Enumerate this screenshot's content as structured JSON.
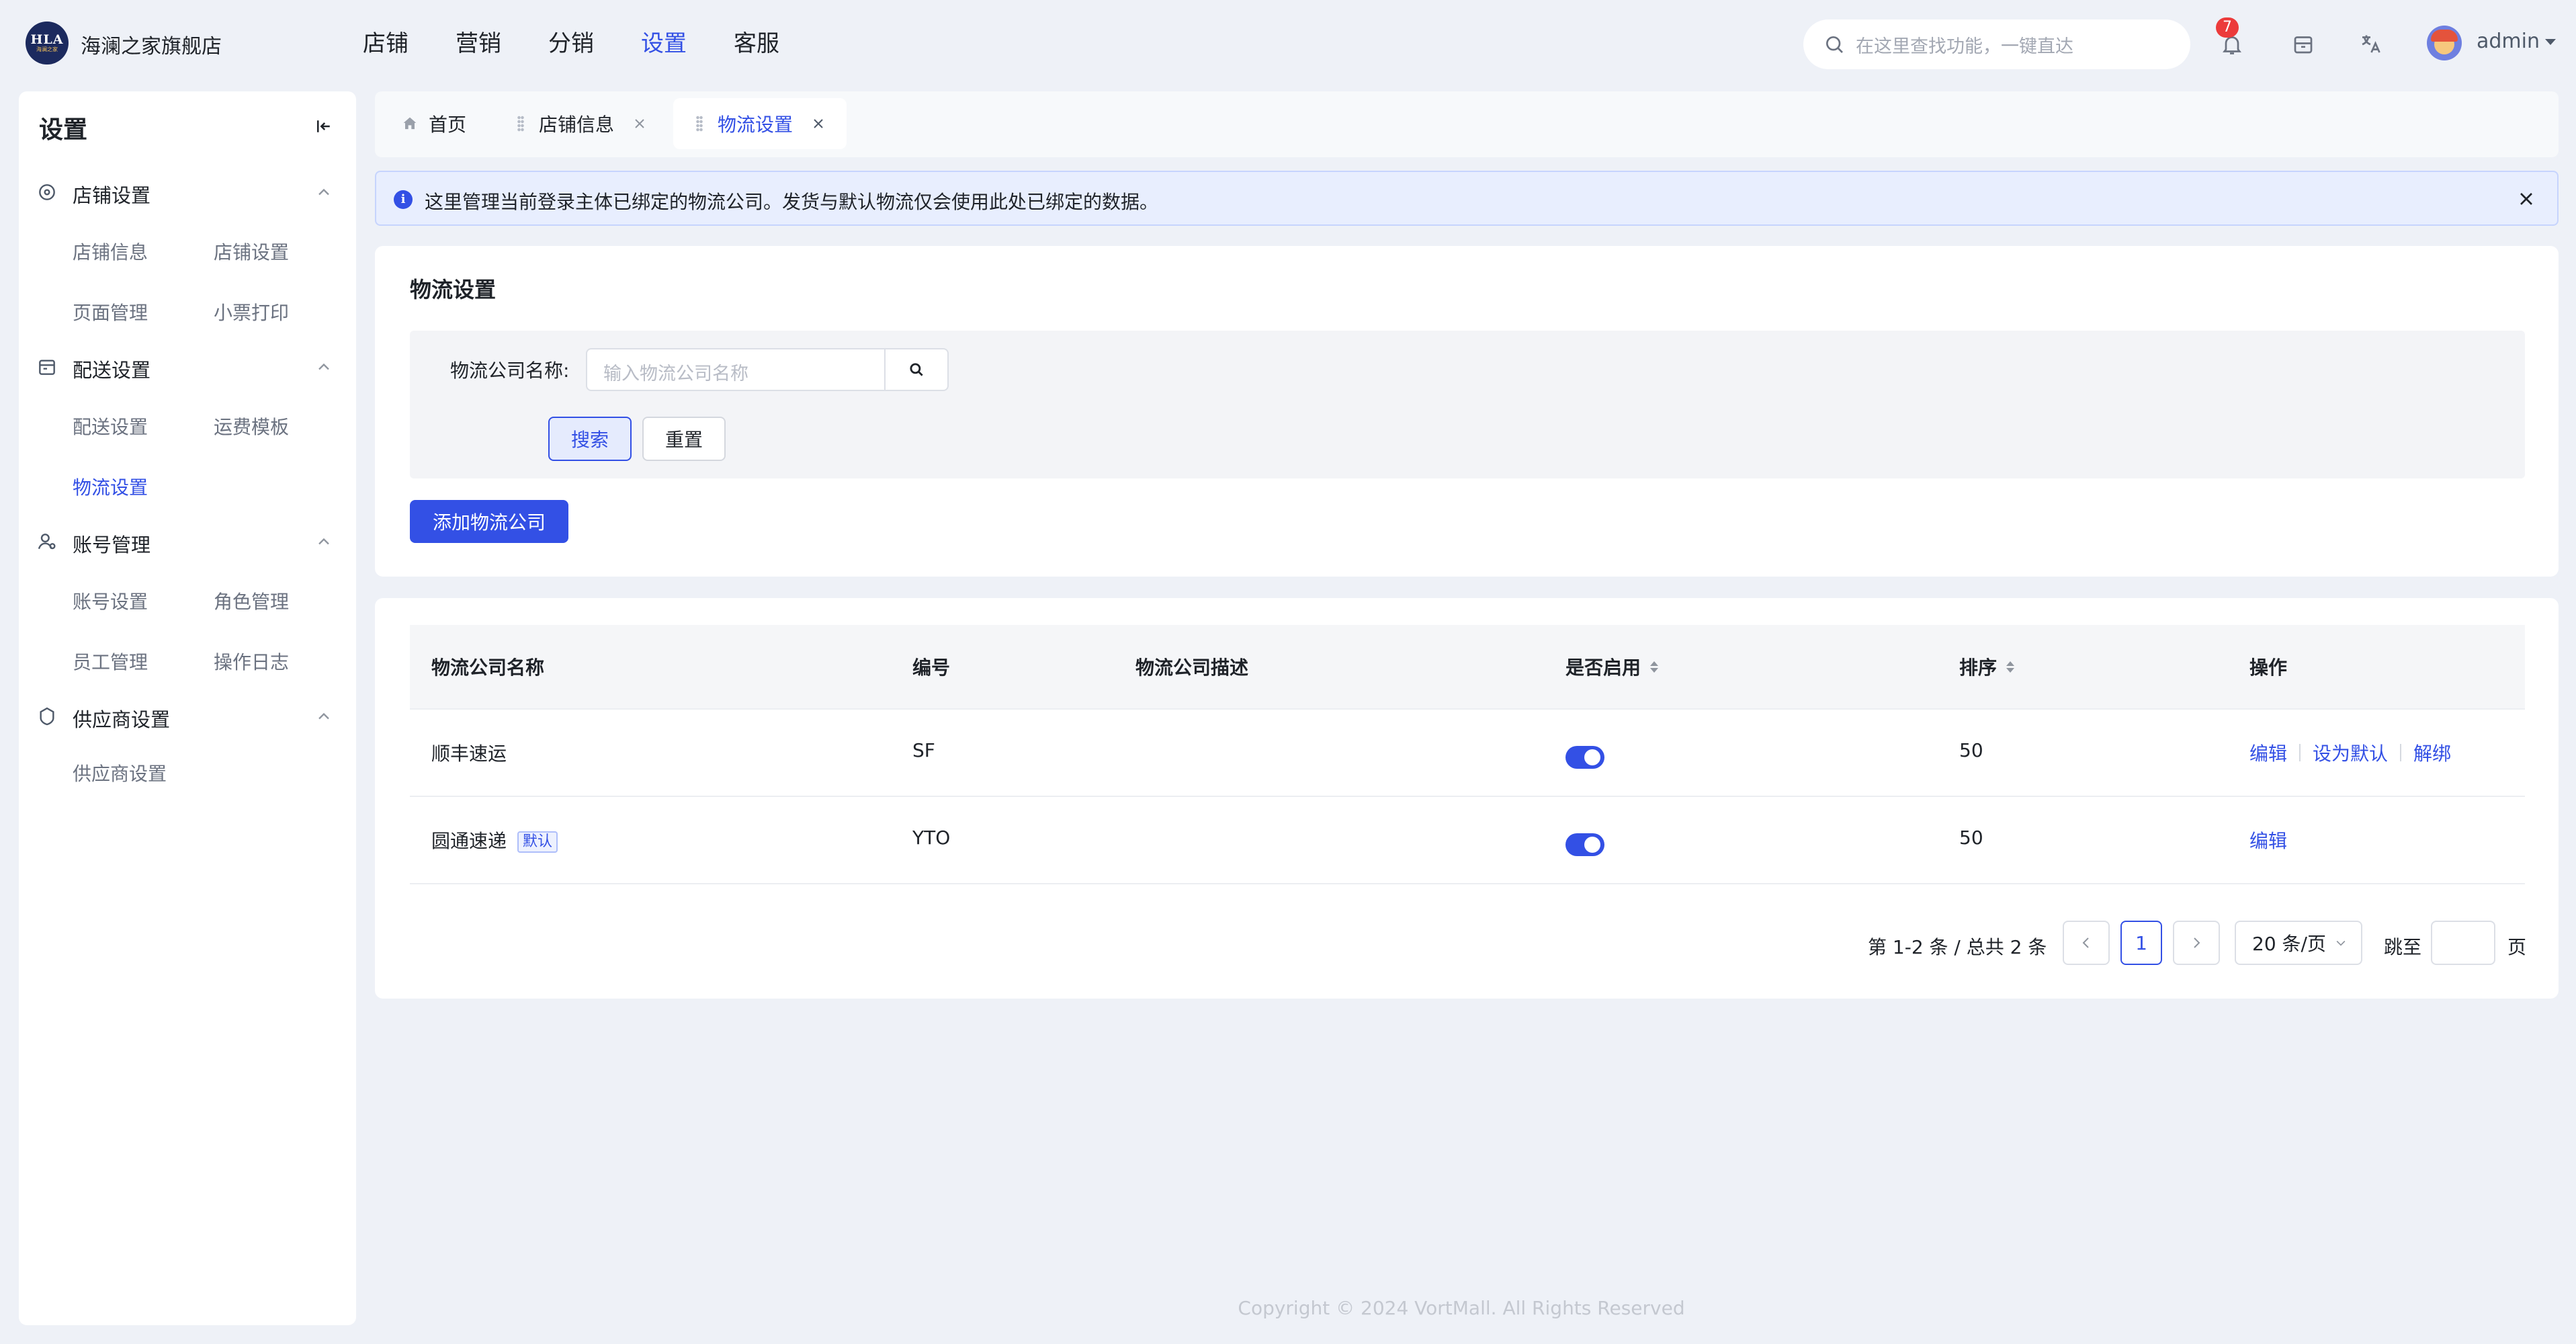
{
  "header": {
    "logo_text": "HLA",
    "logo_sub": "海澜之家",
    "shop_name": "海澜之家旗舰店",
    "nav": [
      "店铺",
      "营销",
      "分销",
      "设置",
      "客服"
    ],
    "active_nav": "设置",
    "search_placeholder": "在这里查找功能，一键直达",
    "notification_count": "7",
    "user_name": "admin"
  },
  "sidebar": {
    "title": "设置",
    "groups": [
      {
        "label": "店铺设置",
        "icon": "store-icon",
        "items": [
          "店铺信息",
          "店铺设置",
          "页面管理",
          "小票打印"
        ]
      },
      {
        "label": "配送设置",
        "icon": "delivery-icon",
        "items": [
          "配送设置",
          "运费模板",
          "物流设置"
        ]
      },
      {
        "label": "账号管理",
        "icon": "user-icon",
        "items": [
          "账号设置",
          "角色管理",
          "员工管理",
          "操作日志"
        ]
      },
      {
        "label": "供应商设置",
        "icon": "supplier-icon",
        "items": [
          "供应商设置"
        ]
      }
    ],
    "active_item": "物流设置"
  },
  "tabs": [
    {
      "label": "首页",
      "icon": "home-icon",
      "closable": false
    },
    {
      "label": "店铺信息",
      "closable": true
    },
    {
      "label": "物流设置",
      "closable": true,
      "active": true
    }
  ],
  "alert": {
    "message": "这里管理当前登录主体已绑定的物流公司。发货与默认物流仅会使用此处已绑定的数据。"
  },
  "filter_card": {
    "title": "物流设置",
    "field_label": "物流公司名称:",
    "field_placeholder": "输入物流公司名称",
    "search_label": "搜索",
    "reset_label": "重置",
    "add_label": "添加物流公司"
  },
  "table": {
    "columns": [
      "物流公司名称",
      "编号",
      "物流公司描述",
      "是否启用",
      "排序",
      "操作"
    ],
    "rows": [
      {
        "name": "顺丰速运",
        "tag": "",
        "code": "SF",
        "desc": "",
        "enabled": true,
        "sort": "50",
        "ops": [
          "编辑",
          "设为默认",
          "解绑"
        ]
      },
      {
        "name": "圆通速递",
        "tag": "默认",
        "code": "YTO",
        "desc": "",
        "enabled": true,
        "sort": "50",
        "ops": [
          "编辑"
        ]
      }
    ]
  },
  "pagination": {
    "total_text": "第 1-2 条 / 总共 2 条",
    "current_page": "1",
    "page_size": "20 条/页",
    "jump_label": "跳至",
    "page_suffix": "页"
  },
  "footer": "Copyright © 2024 VortMall. All Rights Reserved",
  "colors": {
    "primary": "#3350e5",
    "badge": "#ec3b3b",
    "background": "#eef1f7"
  }
}
